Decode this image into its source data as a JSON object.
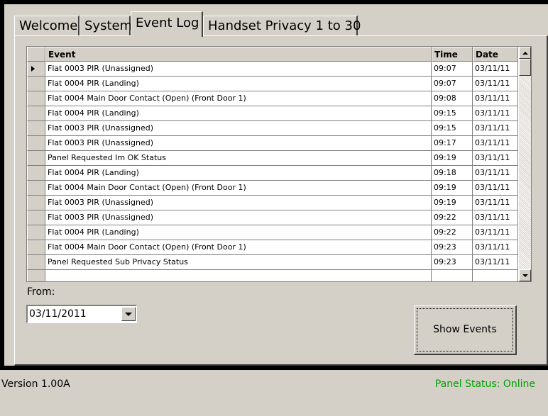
{
  "tabs": [
    {
      "label": "Welcome"
    },
    {
      "label": "System"
    },
    {
      "label": "Event Log"
    },
    {
      "label": "Handset Privacy 1 to 30"
    }
  ],
  "active_tab": "Event Log",
  "grid": {
    "columns": {
      "event": "Event",
      "time": "Time",
      "date": "Date"
    },
    "rows": [
      {
        "event": "Flat 0003 PIR (Unassigned)",
        "time": "09:07",
        "date": "03/11/11"
      },
      {
        "event": "Flat 0004 PIR (Landing)",
        "time": "09:07",
        "date": "03/11/11"
      },
      {
        "event": "Flat 0004 Main Door Contact (Open) (Front Door 1)",
        "time": "09:08",
        "date": "03/11/11"
      },
      {
        "event": "Flat 0004 PIR (Landing)",
        "time": "09:15",
        "date": "03/11/11"
      },
      {
        "event": "Flat 0003 PIR (Unassigned)",
        "time": "09:15",
        "date": "03/11/11"
      },
      {
        "event": "Flat 0003 PIR (Unassigned)",
        "time": "09:17",
        "date": "03/11/11"
      },
      {
        "event": "Panel Requested Im OK Status",
        "time": "09:19",
        "date": "03/11/11"
      },
      {
        "event": "Flat 0004 PIR (Landing)",
        "time": "09:18",
        "date": "03/11/11"
      },
      {
        "event": "Flat 0004 Main Door Contact (Open) (Front Door 1)",
        "time": "09:19",
        "date": "03/11/11"
      },
      {
        "event": "Flat 0003 PIR (Unassigned)",
        "time": "09:19",
        "date": "03/11/11"
      },
      {
        "event": "Flat 0003 PIR (Unassigned)",
        "time": "09:22",
        "date": "03/11/11"
      },
      {
        "event": "Flat 0004 PIR (Landing)",
        "time": "09:22",
        "date": "03/11/11"
      },
      {
        "event": "Flat 0004 Main Door Contact (Open) (Front Door 1)",
        "time": "09:23",
        "date": "03/11/11"
      },
      {
        "event": "Panel Requested Sub Privacy Status",
        "time": "09:23",
        "date": "03/11/11"
      },
      {
        "event": "",
        "time": "",
        "date": ""
      }
    ]
  },
  "from": {
    "label": "From:",
    "value": "03/11/2011"
  },
  "show_events_label": "Show Events",
  "footer": {
    "version": "Version 1.00A",
    "status": "Panel Status: Online"
  },
  "colors": {
    "status_text": "#00a000",
    "background": "#d4d0c8"
  }
}
